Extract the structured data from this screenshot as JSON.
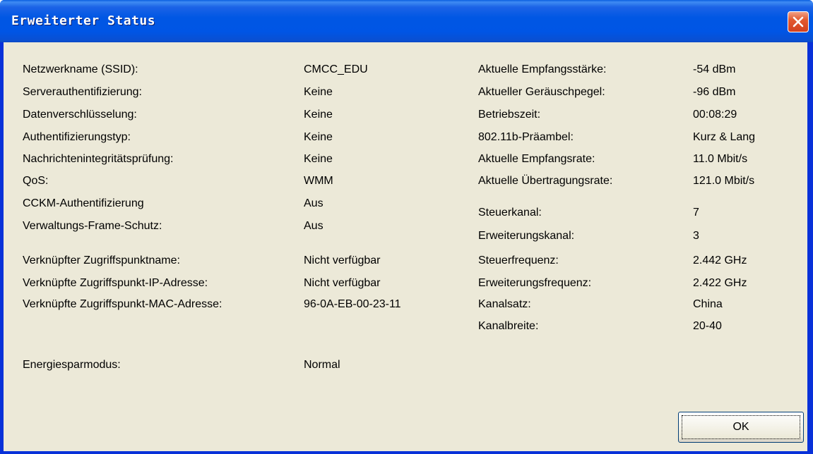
{
  "window": {
    "title": "Erweiterter Status"
  },
  "left": [
    {
      "label": "Netzwerkname (SSID):",
      "value": "CMCC_EDU"
    },
    {
      "label": "Serverauthentifizierung:",
      "value": "Keine"
    },
    {
      "label": "Datenverschlüsselung:",
      "value": "Keine"
    },
    {
      "label": "Authentifizierungstyp:",
      "value": "Keine"
    },
    {
      "label": "Nachrichtenintegritätsprüfung:",
      "value": "Keine"
    },
    {
      "label": "QoS:",
      "value": "WMM"
    },
    {
      "label": "CCKM-Authentifizierung",
      "value": "Aus"
    },
    {
      "label": "Verwaltungs-Frame-Schutz:",
      "value": "Aus"
    },
    {
      "label": "Verknüpfter Zugriffspunktname:",
      "value": "Nicht verfügbar"
    },
    {
      "label": "Verknüpfte Zugriffspunkt-IP-Adresse:",
      "value": "Nicht verfügbar"
    },
    {
      "label": "Verknüpfte Zugriffspunkt-MAC-Adresse:",
      "value": "96-0A-EB-00-23-11"
    },
    {
      "label": "Energiesparmodus:",
      "value": "Normal"
    }
  ],
  "right": [
    {
      "label": "Aktuelle Empfangsstärke:",
      "value": "-54 dBm"
    },
    {
      "label": "Aktueller Geräuschpegel:",
      "value": "-96 dBm"
    },
    {
      "label": "Betriebszeit:",
      "value": "00:08:29"
    },
    {
      "label": "802.11b-Präambel:",
      "value": "Kurz & Lang"
    },
    {
      "label": "Aktuelle Empfangsrate:",
      "value": "11.0 Mbit/s"
    },
    {
      "label": "Aktuelle Übertragungsrate:",
      "value": "121.0 Mbit/s"
    },
    {
      "label": "Steuerkanal:",
      "value": "7"
    },
    {
      "label": "Erweiterungskanal:",
      "value": "3"
    },
    {
      "label": "Steuerfrequenz:",
      "value": "2.442 GHz"
    },
    {
      "label": "Erweiterungsfrequenz:",
      "value": "2.422 GHz"
    },
    {
      "label": "Kanalsatz:",
      "value": "China"
    },
    {
      "label": "Kanalbreite:",
      "value": "20-40"
    }
  ],
  "buttons": {
    "ok": "OK",
    "close_icon": "close-icon"
  },
  "colors": {
    "titlebar": "#0055e5",
    "client_bg": "#ece9d8",
    "close_button": "#e2592f"
  }
}
